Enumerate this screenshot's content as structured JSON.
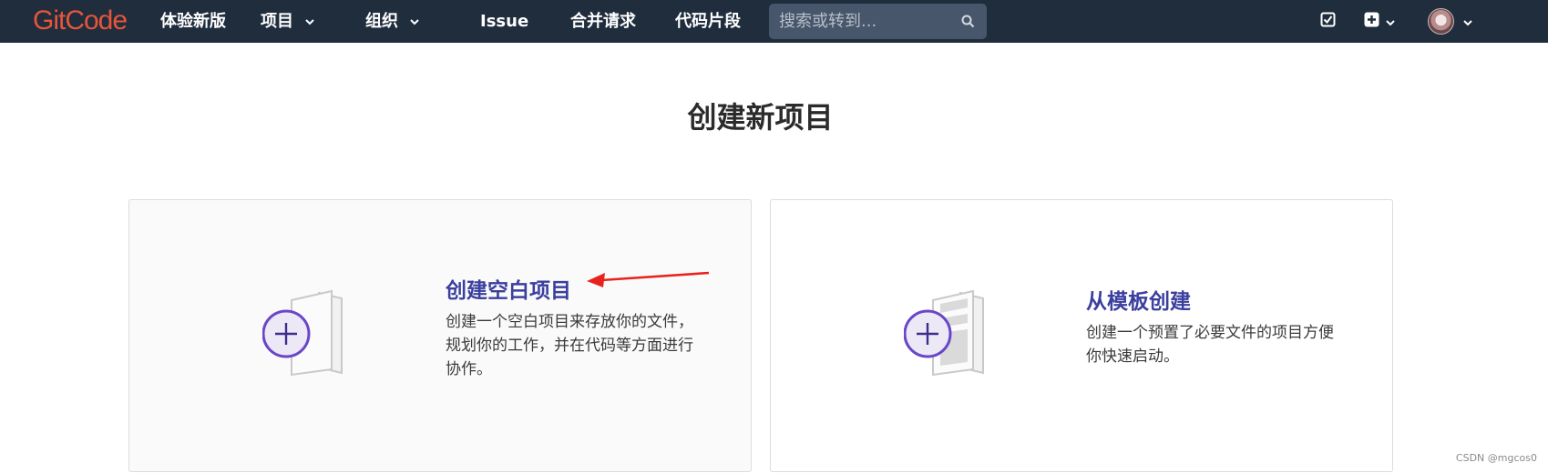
{
  "header": {
    "logo_text": "GitCode",
    "nav": [
      {
        "label": "体验新版",
        "has_dropdown": false
      },
      {
        "label": "项目",
        "has_dropdown": true
      },
      {
        "label": "组织",
        "has_dropdown": true
      },
      {
        "label": "Issue",
        "has_dropdown": false
      },
      {
        "label": "合并请求",
        "has_dropdown": false
      },
      {
        "label": "代码片段",
        "has_dropdown": false
      }
    ],
    "search": {
      "placeholder": "搜索或转到..."
    },
    "right_icons": [
      "todo-check-icon",
      "plus-square-icon",
      "user-avatar"
    ],
    "colors": {
      "background": "#1f2d3d",
      "logo": "#e8543a",
      "search_bg": "#47566a"
    }
  },
  "page_title": "创建新项目",
  "cards": [
    {
      "title": "创建空白项目",
      "description": "创建一个空白项目来存放你的文件，规划你的工作，并在代码等方面进行协作。",
      "icon": "blank-project-icon"
    },
    {
      "title": "从模板创建",
      "description": "创建一个预置了必要文件的项目方便你快速启动。",
      "icon": "template-project-icon"
    }
  ],
  "accent_colors": {
    "card_title": "#3b3f9e",
    "plus_circle": "#6a46c8",
    "annotation_arrow": "#e8231e"
  },
  "watermark": "CSDN @mgcos0"
}
